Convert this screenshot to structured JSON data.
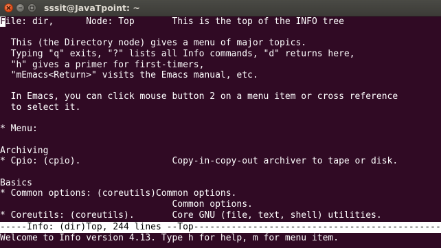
{
  "window": {
    "title": "sssit@JavaTpoint: ~",
    "buttons": [
      "close-icon",
      "minimize-icon",
      "maximize-icon"
    ]
  },
  "terminal": {
    "cursor_char": "F",
    "lines": [
      "ile: dir,      Node: Top       This is the top of the INFO tree",
      "",
      "  This (the Directory node) gives a menu of major topics.",
      "  Typing \"q\" exits, \"?\" lists all Info commands, \"d\" returns here,",
      "  \"h\" gives a primer for first-timers,",
      "  \"mEmacs<Return>\" visits the Emacs manual, etc.",
      "",
      "  In Emacs, you can click mouse button 2 on a menu item or cross reference",
      "  to select it.",
      "",
      "* Menu:",
      "",
      "Archiving",
      "* Cpio: (cpio).                 Copy-in-copy-out archiver to tape or disk.",
      "",
      "Basics",
      "* Common options: (coreutils)Common options.",
      "                                Common options.",
      "* Coreutils: (coreutils).       Core GNU (file, text, shell) utilities."
    ],
    "mode_line": "-----Info: (dir)Top, 244 lines --Top----------------------------------------------",
    "echo_area": "Welcome to Info version 4.13. Type h for help, m for menu item."
  },
  "colors": {
    "terminal_bg": "#300a24",
    "terminal_fg": "#ffffff",
    "titlebar_bg": "#3c3b37",
    "close_button": "#df4a16"
  }
}
